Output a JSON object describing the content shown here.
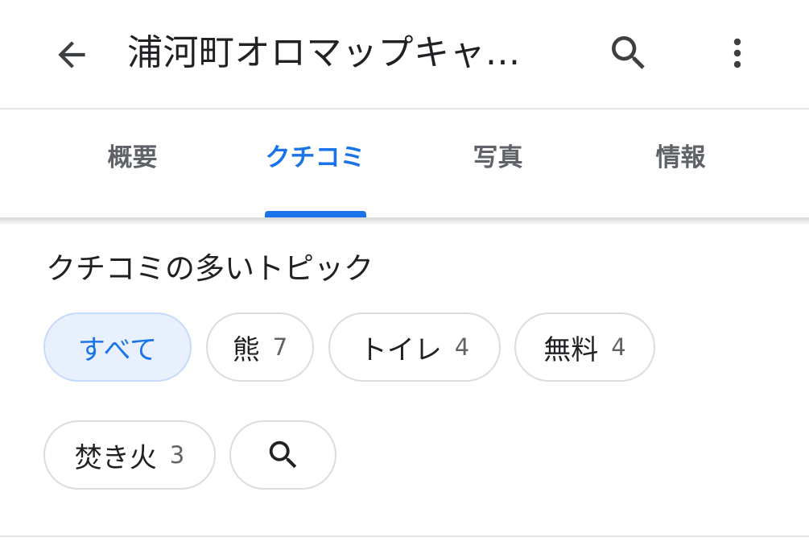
{
  "header": {
    "title": "浦河町オロマップキャ...",
    "back_icon": "arrow-left-icon",
    "search_icon": "search-icon",
    "more_icon": "more-vert-icon"
  },
  "tabs": [
    {
      "label": "概要",
      "active": false
    },
    {
      "label": "クチコミ",
      "active": true
    },
    {
      "label": "写真",
      "active": false
    },
    {
      "label": "情報",
      "active": false
    }
  ],
  "topics": {
    "title": "クチコミの多いトピック",
    "chips": [
      {
        "label": "すべて",
        "count": "",
        "selected": true
      },
      {
        "label": "熊",
        "count": "7",
        "selected": false
      },
      {
        "label": "トイレ",
        "count": "4",
        "selected": false
      },
      {
        "label": "無料",
        "count": "4",
        "selected": false
      },
      {
        "label": "焚き火",
        "count": "3",
        "selected": false
      }
    ],
    "search_icon": "search-icon"
  },
  "colors": {
    "accent": "#1a73e8",
    "selected_chip_bg": "#e8f0fe",
    "text_primary": "#202124",
    "text_secondary": "#5f6368",
    "divider": "#e4e4e4"
  }
}
